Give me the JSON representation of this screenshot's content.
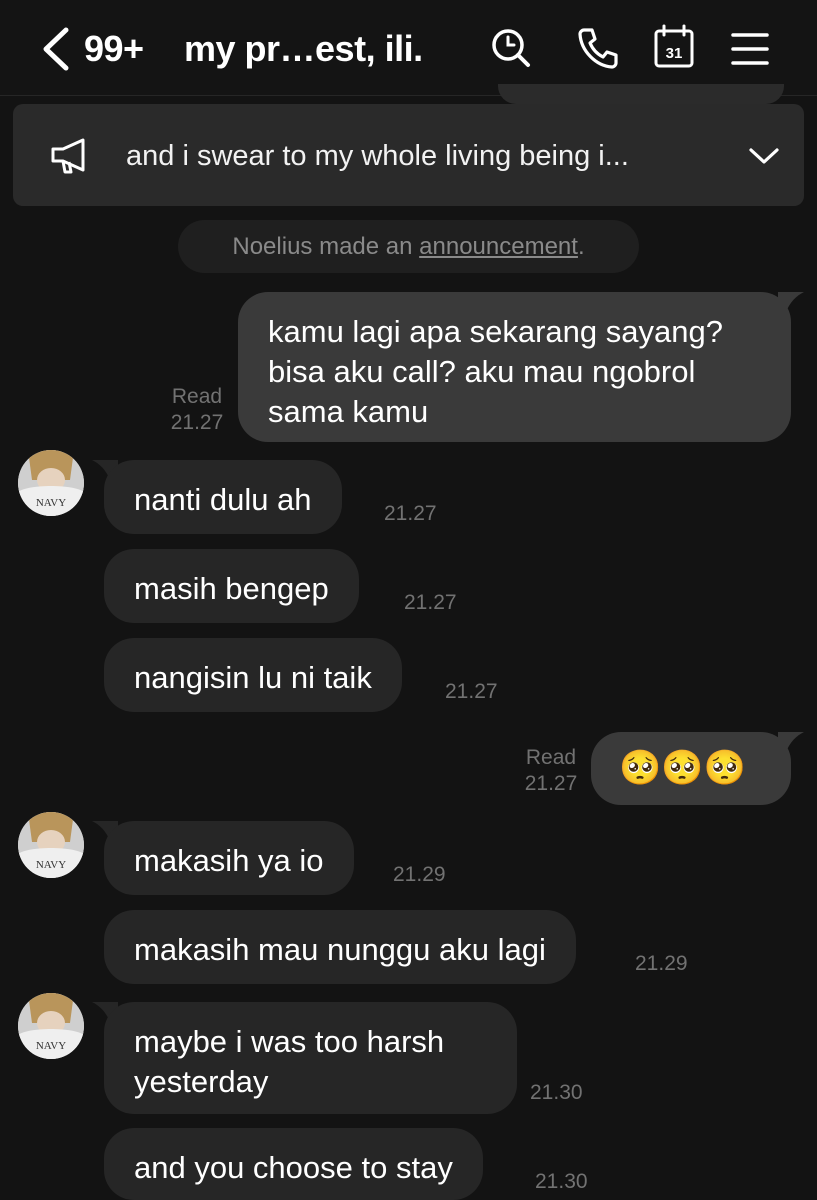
{
  "header": {
    "unread_count": "99+",
    "chat_title": "my pr…est, ili.",
    "calendar_day": "31"
  },
  "announcement": {
    "text": "and i swear to my whole living being i..."
  },
  "system": {
    "prefix": "Noelius made an ",
    "link": "announcement",
    "suffix": "."
  },
  "messages": [
    {
      "text": "kamu lagi apa sekarang sayang? bisa aku call? aku mau ngobrol sama kamu",
      "status": "Read",
      "time": "21.27"
    },
    {
      "text": "nanti dulu ah",
      "time": "21.27"
    },
    {
      "text": "masih bengep",
      "time": "21.27"
    },
    {
      "text": "nangisin lu ni taik",
      "time": "21.27"
    },
    {
      "text": "🥺🥺🥺",
      "status": "Read",
      "time": "21.27"
    },
    {
      "text": "makasih ya io",
      "time": "21.29"
    },
    {
      "text": "makasih mau nunggu aku lagi",
      "time": "21.29"
    },
    {
      "text": "maybe i was too harsh yesterday",
      "time": "21.30"
    },
    {
      "text": "and you choose to stay",
      "time": "21.30"
    }
  ],
  "avatar_print": "NAVY"
}
